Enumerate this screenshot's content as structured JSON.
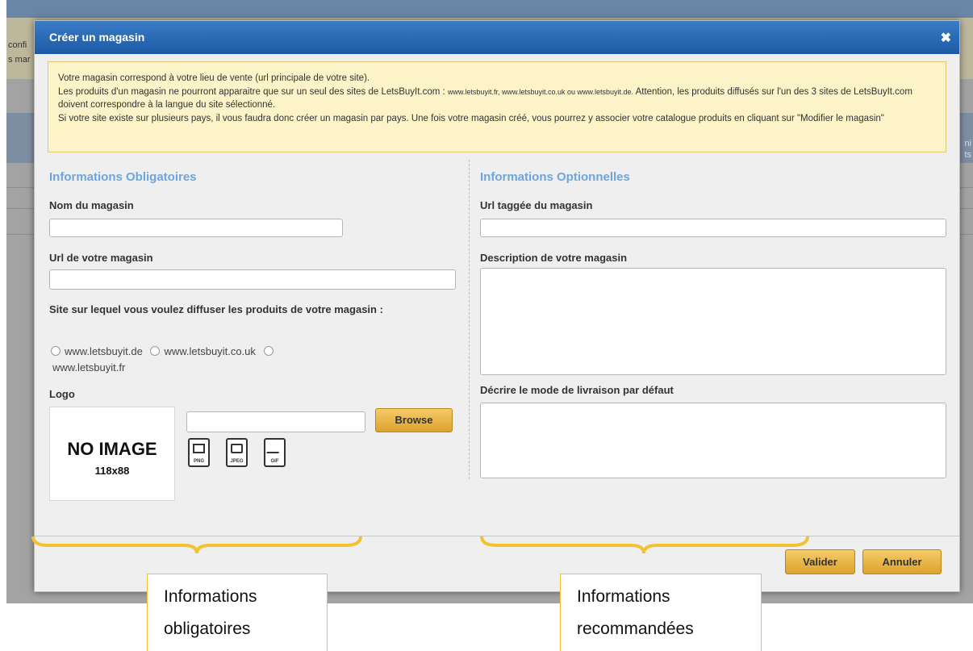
{
  "background": {
    "notice_fragments": [
      "confi",
      "s mar"
    ],
    "right_fragments": [
      "ni",
      "ts"
    ]
  },
  "modal": {
    "title": "Créer un magasin",
    "close_symbol": "✖",
    "info": {
      "p1": "Votre magasin correspond à votre lieu de vente (url principale de votre site).",
      "p2a": "Les produits d'un magasin ne pourront apparaitre que sur un seul des sites de LetsBuyIt.com : ",
      "p2_sites": "www.letsbuyit.fr, www.letsbuyit.co.uk ou www.letsbuyit.de.",
      "p2b": " Attention, les produits diffusés sur l'un des 3 sites de LetsBuyIt.com doivent correspondre à la langue du site sélectionné.",
      "p3": "Si votre site existe sur plusieurs pays, il vous faudra donc créer un magasin par pays. Une fois votre magasin créé, vous pourrez y associer votre catalogue produits en cliquant sur \"Modifier le magasin\""
    },
    "left": {
      "section_title": "Informations Obligatoires",
      "name_label": "Nom du magasin",
      "name_value": "",
      "url_label": "Url de votre magasin",
      "url_value": "",
      "site_label": "Site sur lequel vous voulez diffuser les produits de votre magasin :",
      "sites": [
        "www.letsbuyit.de",
        "www.letsbuyit.co.uk",
        "www.letsbuyit.fr"
      ],
      "logo_label": "Logo",
      "noimage_text": "NO IMAGE",
      "noimage_dims": "118x88",
      "file_value": "",
      "browse_label": "Browse",
      "file_types": [
        "PNG",
        "JPEG",
        "GIF"
      ]
    },
    "right": {
      "section_title": "Informations Optionnelles",
      "tagged_url_label": "Url taggée du magasin",
      "tagged_url_value": "",
      "description_label": "Description de votre magasin",
      "description_value": "",
      "delivery_label": "Décrire le mode de livraison par défaut",
      "delivery_value": ""
    },
    "buttons": {
      "validate": "Valider",
      "cancel": "Annuler"
    }
  },
  "annotations": {
    "left_lines": [
      "Informations",
      "obligatoires"
    ],
    "right_lines": [
      "Informations",
      "recommandées"
    ],
    "brace_color": "#f2c230"
  }
}
